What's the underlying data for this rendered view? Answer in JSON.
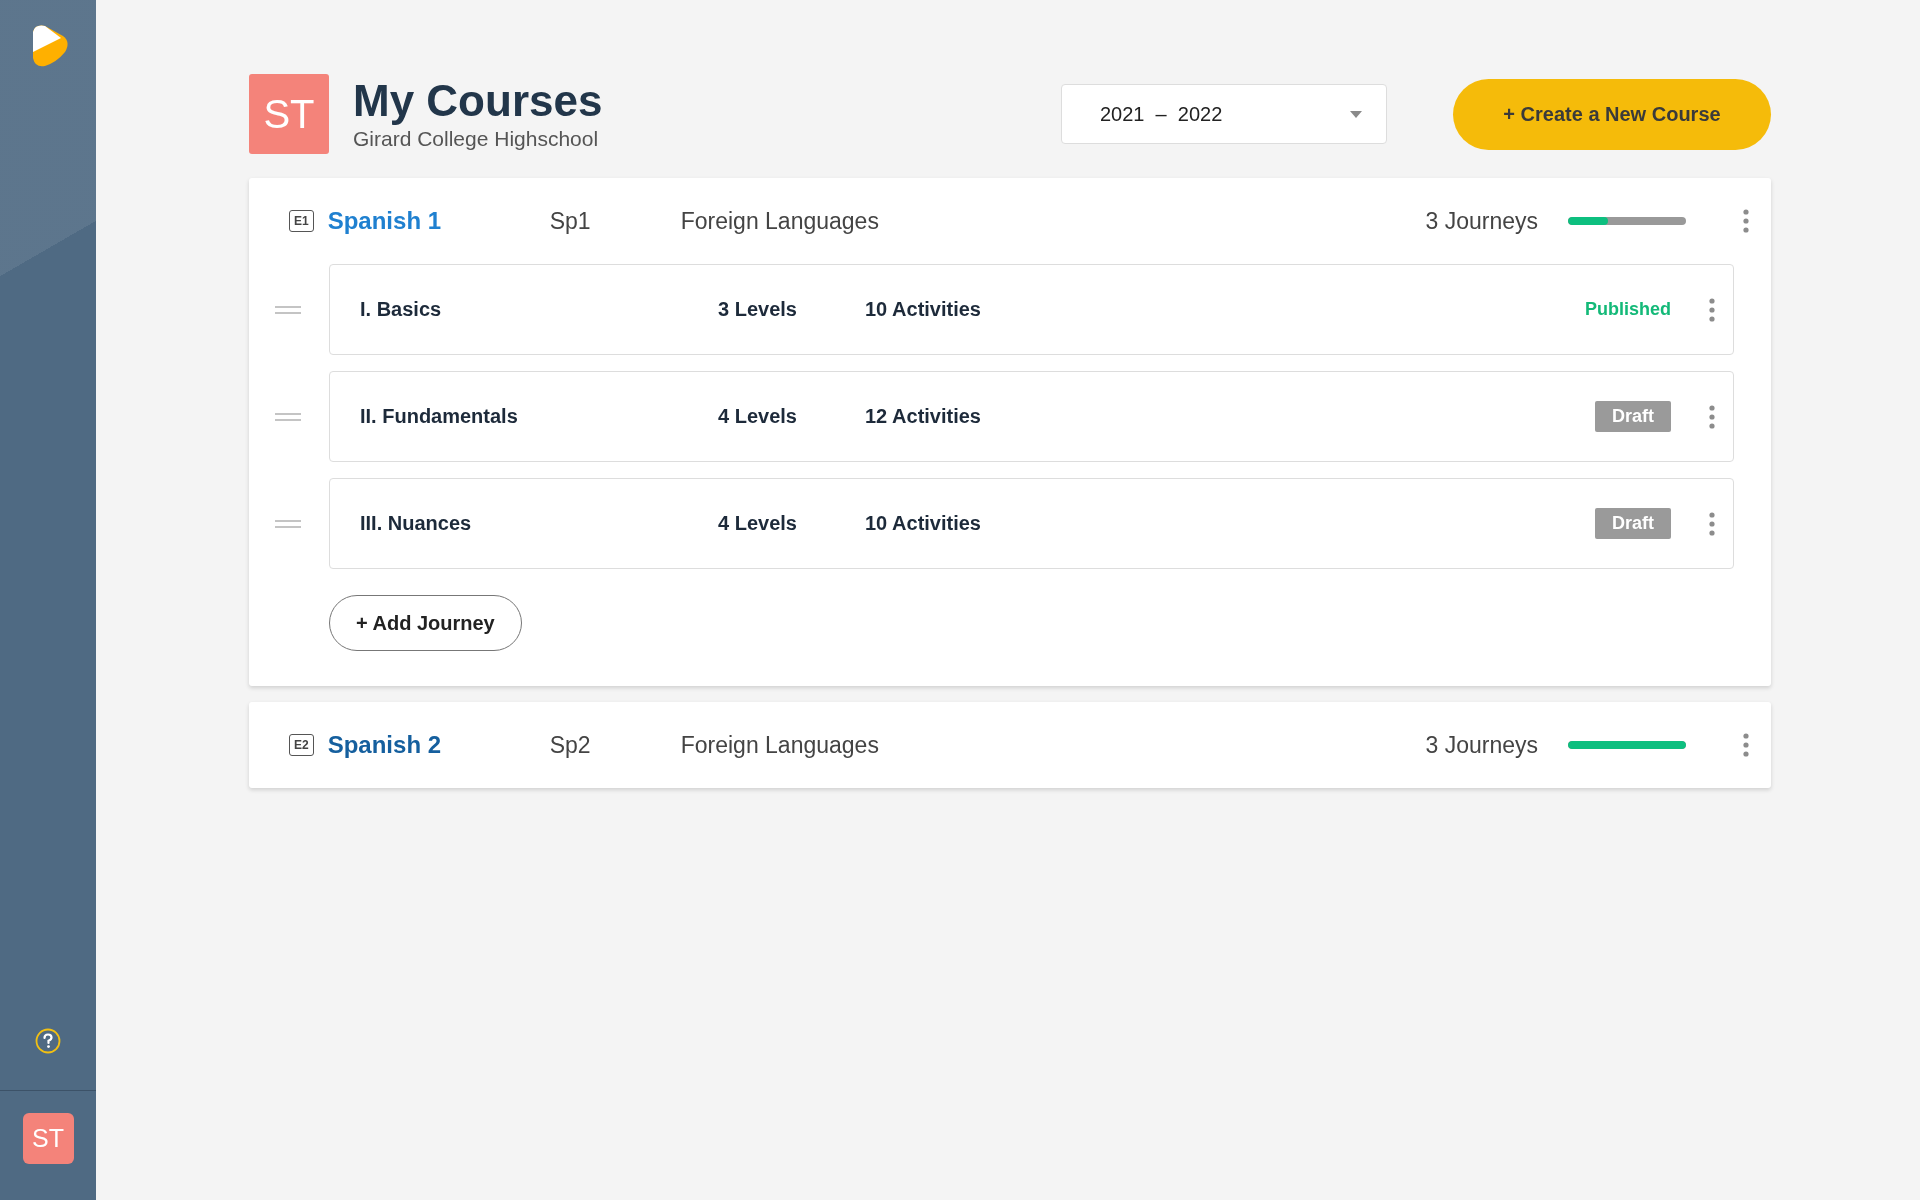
{
  "sidebar": {
    "avatar": "ST"
  },
  "header": {
    "avatar": "ST",
    "title": "My Courses",
    "subtitle": "Girard College Highschool",
    "year_select": {
      "value": "2021  –  2022"
    },
    "create_button": "+ Create a New Course"
  },
  "courses": [
    {
      "code": "E1",
      "name": "Spanish 1",
      "color": "#1f80d0",
      "short": "Sp1",
      "subject": "Foreign Languages",
      "journeys": "3 Journeys",
      "level": 0.34,
      "expanded": true,
      "journey_list": [
        {
          "title": "I. Basics",
          "levels": "3 Levels",
          "activities": "10 Activities",
          "status": "Published",
          "kind": "published"
        },
        {
          "title": "II. Fundamentals",
          "levels": "4 Levels",
          "activities": "12 Activities",
          "status": "Draft",
          "kind": "draft"
        },
        {
          "title": "III. Nuances",
          "levels": "4 Levels",
          "activities": "10 Activities",
          "status": "Draft",
          "kind": "draft"
        }
      ],
      "add_button": "+ Add Journey"
    },
    {
      "code": "E2",
      "name": "Spanish 2",
      "color": "#155f9e",
      "short": "Sp2",
      "subject": "Foreign Languages",
      "journeys": "3 Journeys",
      "level": 1.0,
      "expanded": false
    }
  ]
}
